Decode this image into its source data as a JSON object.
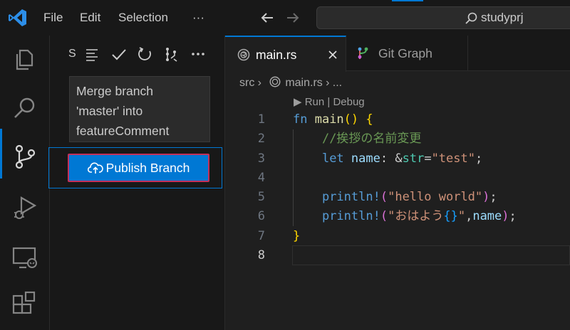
{
  "menu": {
    "file": "File",
    "edit": "Edit",
    "selection": "Selection",
    "more": "···"
  },
  "search": {
    "text": "studyprj"
  },
  "sidebar": {
    "title_initial": "S",
    "commit_message_lines": [
      "Merge branch",
      "'master' into",
      "featureComment"
    ],
    "publish_label": "Publish Branch"
  },
  "tabs": [
    {
      "label": "main.rs",
      "active": true
    },
    {
      "label": "Git Graph",
      "active": false
    }
  ],
  "breadcrumb": {
    "folder": "src",
    "file": "main.rs",
    "more": "..."
  },
  "codelens": "▶ Run | Debug",
  "line_numbers": [
    "1",
    "2",
    "3",
    "4",
    "5",
    "6",
    "7",
    "8"
  ],
  "code": {
    "l1": {
      "kw": "fn",
      "name": " main",
      "parens": "()",
      "brace": " {"
    },
    "l2": {
      "comment": "//挨拶の名前変更"
    },
    "l3": {
      "kw": "let",
      "var": " name",
      "colon": ": ",
      "amp": "&",
      "type": "str",
      "eq": "=",
      "str": "\"test\"",
      "semi": ";"
    },
    "l5": {
      "macro": "println!",
      "open": "(",
      "str": "\"hello world\"",
      "close": ")",
      "semi": ";"
    },
    "l6": {
      "macro": "println!",
      "open": "(",
      "str1": "\"おはよう",
      "ph": "{}",
      "str2": "\"",
      "comma": ",",
      "var": "name",
      "close": ")",
      "semi": ";"
    },
    "l7": {
      "brace": "}"
    }
  },
  "colors": {
    "accent": "#0078d4",
    "publish_outline": "#c3305a",
    "background": "#1f1f1f",
    "chrome": "#181818"
  },
  "icons": [
    "vscode-logo-icon",
    "back-arrow-icon",
    "forward-arrow-icon",
    "search-icon",
    "explorer-icon",
    "activity-search-icon",
    "source-control-icon",
    "run-debug-icon",
    "remote-explorer-icon",
    "extensions-icon",
    "view-as-tree-icon",
    "commit-check-icon",
    "refresh-icon",
    "branch-graph-icon",
    "more-actions-icon",
    "cloud-upload-icon",
    "rust-file-icon",
    "git-graph-icon",
    "close-icon"
  ]
}
